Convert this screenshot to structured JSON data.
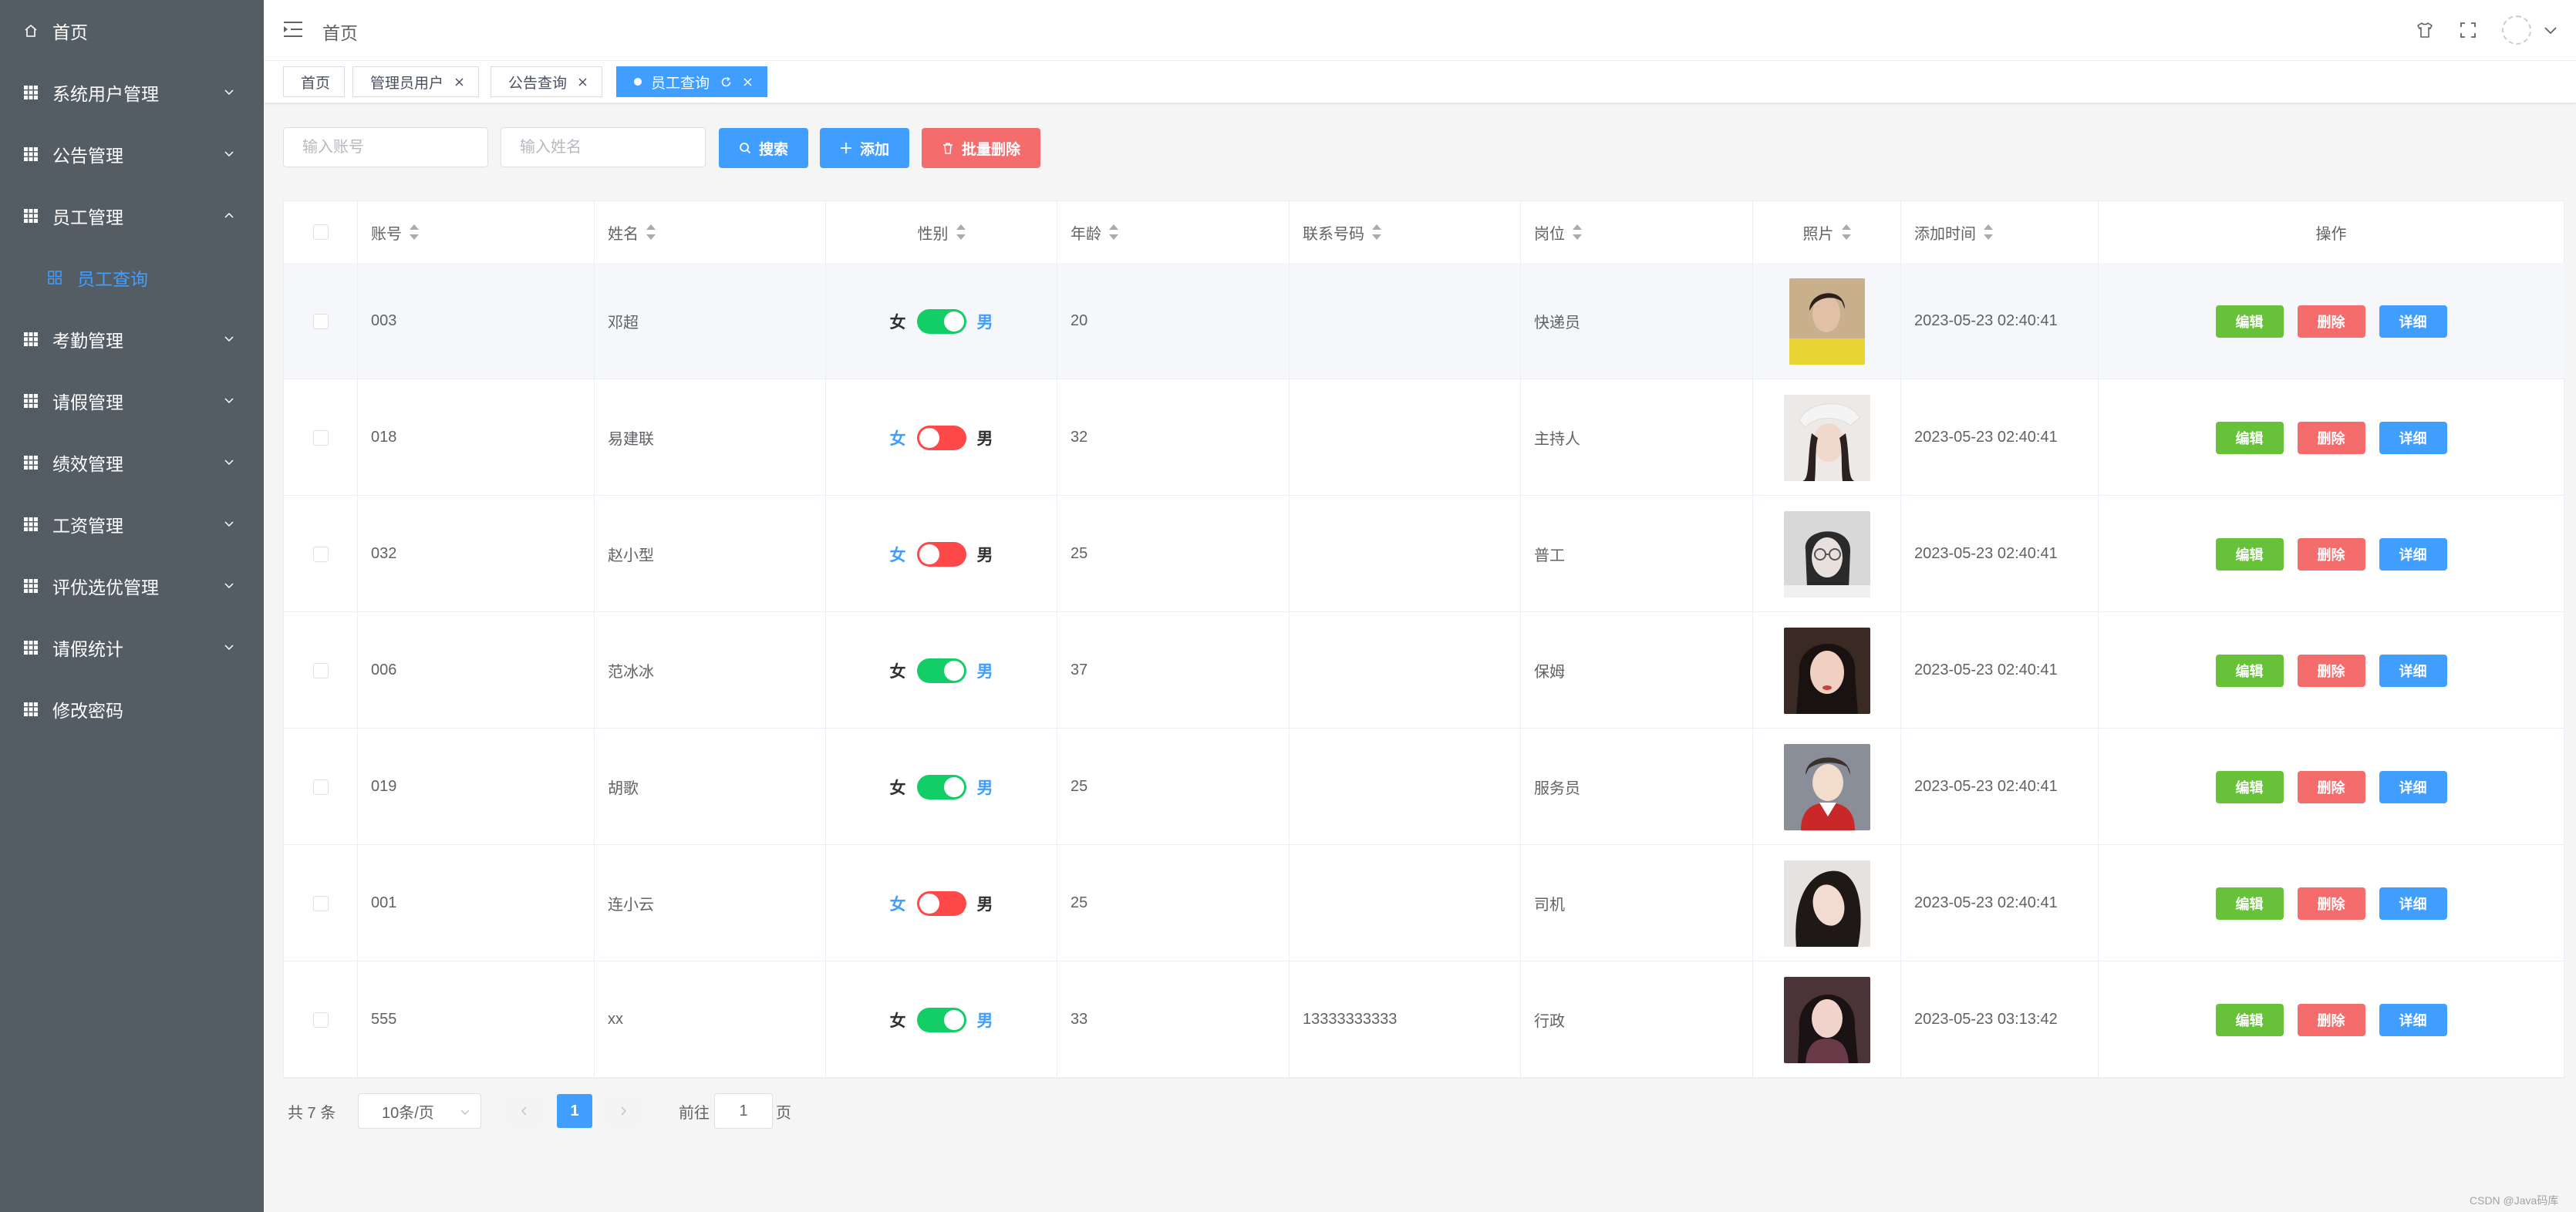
{
  "sidebar": {
    "items": [
      {
        "label": "首页",
        "icon": "home-icon"
      },
      {
        "label": "系统用户管理",
        "icon": "grid-icon"
      },
      {
        "label": "公告管理",
        "icon": "grid-icon"
      },
      {
        "label": "员工管理",
        "icon": "grid-icon"
      },
      {
        "label": "员工查询",
        "icon": "grid-outline-icon"
      },
      {
        "label": "考勤管理",
        "icon": "grid-icon"
      },
      {
        "label": "请假管理",
        "icon": "grid-icon"
      },
      {
        "label": "绩效管理",
        "icon": "grid-icon"
      },
      {
        "label": "工资管理",
        "icon": "grid-icon"
      },
      {
        "label": "评优选优管理",
        "icon": "grid-icon"
      },
      {
        "label": "请假统计",
        "icon": "grid-icon"
      },
      {
        "label": "修改密码",
        "icon": "grid-icon"
      }
    ],
    "active_color": "#409eff",
    "bg_color": "#545c64"
  },
  "header": {
    "breadcrumb": "首页"
  },
  "tags": [
    {
      "label": "首页"
    },
    {
      "label": "管理员用户"
    },
    {
      "label": "公告查询"
    },
    {
      "label": "员工查询"
    }
  ],
  "search": {
    "account_placeholder": "输入账号",
    "name_placeholder": "输入姓名",
    "search_label": "搜索",
    "add_label": "添加",
    "batch_delete_label": "批量删除"
  },
  "table": {
    "columns": [
      "账号",
      "姓名",
      "性别",
      "年龄",
      "联系号码",
      "岗位",
      "照片",
      "添加时间",
      "操作"
    ],
    "gender_female": "女",
    "gender_male": "男",
    "op_edit": "编辑",
    "op_delete": "删除",
    "op_detail": "详细",
    "rows": [
      {
        "account": "003",
        "name": "邓超",
        "male": true,
        "age": "20",
        "phone": "",
        "job": "快递员",
        "time": "2023-05-23 02:40:41"
      },
      {
        "account": "018",
        "name": "易建联",
        "male": false,
        "age": "32",
        "phone": "",
        "job": "主持人",
        "time": "2023-05-23 02:40:41"
      },
      {
        "account": "032",
        "name": "赵小型",
        "male": false,
        "age": "25",
        "phone": "",
        "job": "普工",
        "time": "2023-05-23 02:40:41"
      },
      {
        "account": "006",
        "name": "范冰冰",
        "male": true,
        "age": "37",
        "phone": "",
        "job": "保姆",
        "time": "2023-05-23 02:40:41"
      },
      {
        "account": "019",
        "name": "胡歌",
        "male": true,
        "age": "25",
        "phone": "",
        "job": "服务员",
        "time": "2023-05-23 02:40:41"
      },
      {
        "account": "001",
        "name": "连小云",
        "male": false,
        "age": "25",
        "phone": "",
        "job": "司机",
        "time": "2023-05-23 02:40:41"
      },
      {
        "account": "555",
        "name": "xx",
        "male": true,
        "age": "33",
        "phone": "13333333333",
        "job": "行政",
        "time": "2023-05-23 03:13:42"
      }
    ]
  },
  "pagination": {
    "total": "共 7 条",
    "page_size": "10条/页",
    "current_page": "1",
    "goto_prefix": "前往",
    "goto_value": "1",
    "goto_suffix": "页"
  },
  "colors": {
    "primary": "#409eff",
    "success": "#67c23a",
    "danger": "#f56c6c",
    "switch_on": "#13ce66",
    "switch_off": "#ff4949"
  },
  "watermark": "CSDN @Java码库"
}
